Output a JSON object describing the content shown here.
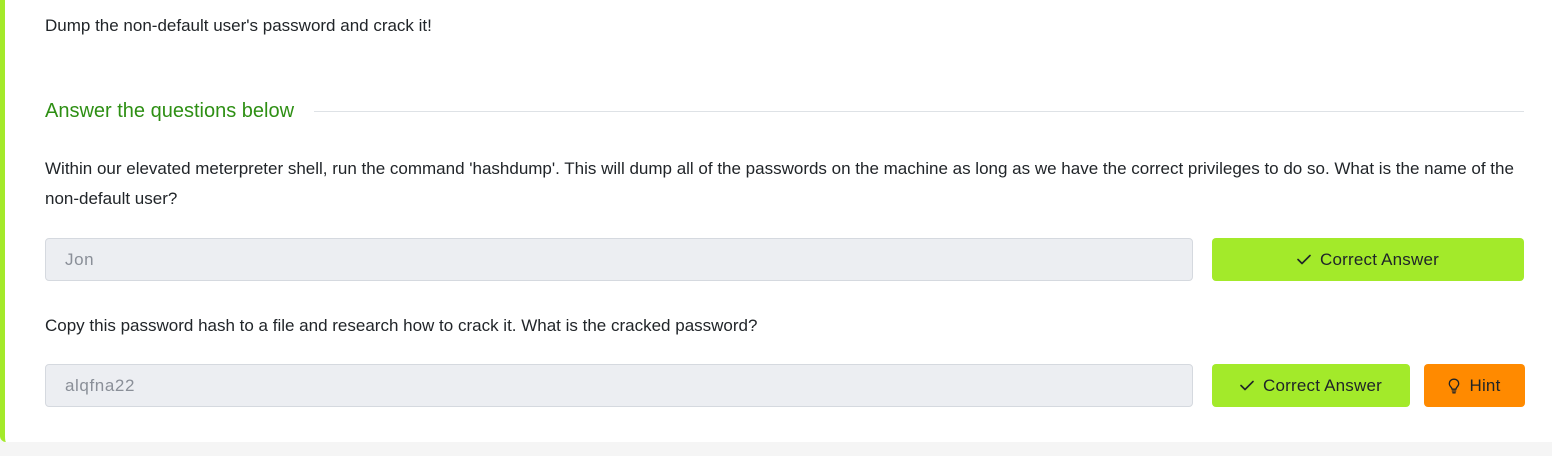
{
  "task": {
    "intro": "Dump the non-default user's password and crack it!",
    "section_title": "Answer the questions below"
  },
  "questions": [
    {
      "text": "Within our elevated meterpreter shell, run the command 'hashdump'. This will dump all of the passwords on the machine as long as we have the correct privileges to do so. What is the name of the non-default user?",
      "answer": "Jon",
      "button_label": "Correct Answer"
    },
    {
      "text": "Copy this password hash to a file and research how to crack it. What is the cracked password?",
      "answer": "alqfna22",
      "button_label": "Correct Answer",
      "hint_label": "Hint"
    }
  ],
  "icons": {
    "correct": "check-icon",
    "hint": "lightbulb-icon"
  },
  "colors": {
    "accent": "#a3ea2a",
    "section_title": "#2e8f14",
    "hint": "#ff8a00",
    "input_bg": "#eceef2"
  }
}
